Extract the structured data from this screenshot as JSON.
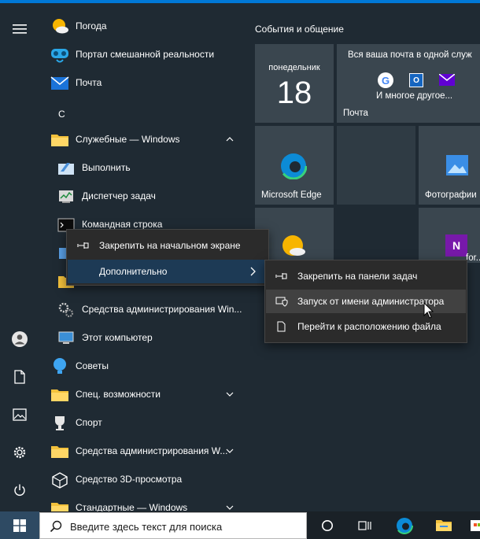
{
  "start_menu": {
    "apps": [
      {
        "label": "Погода",
        "icon": "weather-icon"
      },
      {
        "label": "Портал смешанной реальности",
        "icon": "mixed-reality-icon"
      },
      {
        "label": "Почта",
        "icon": "mail-icon"
      },
      {
        "label": "Служебные — Windows",
        "icon": "folder-icon"
      },
      {
        "label": "Выполнить",
        "icon": "run-icon"
      },
      {
        "label": "Диспетчер задач",
        "icon": "task-manager-icon"
      },
      {
        "label": "Командная строка",
        "icon": "cmd-icon"
      },
      {
        "label": "Средства администрирования Win...",
        "icon": "admin-tools-icon"
      },
      {
        "label": "Этот компьютер",
        "icon": "computer-icon"
      },
      {
        "label": "Советы",
        "icon": "tips-icon"
      },
      {
        "label": "Спец. возможности",
        "icon": "folder-icon"
      },
      {
        "label": "Спорт",
        "icon": "sport-icon"
      },
      {
        "label": "Средства администрирования W...",
        "icon": "folder-icon"
      },
      {
        "label": "Средство 3D-просмотра",
        "icon": "3d-viewer-icon"
      },
      {
        "label": "Стандартные — Windows",
        "icon": "folder-icon"
      }
    ],
    "letter_header": "С"
  },
  "tiles": {
    "group_title": "События и общение",
    "calendar": {
      "day": "понедельник",
      "date": "18"
    },
    "mail": {
      "headline": "Вся ваша почта в одной служ",
      "more": "И многое другое...",
      "label": "Почта"
    },
    "edge": {
      "label": "Microsoft Edge"
    },
    "photos": {
      "label": "Фотографии"
    },
    "onenote": {
      "label": "for..."
    }
  },
  "context_menu": {
    "pin_start": "Закрепить на начальном экране",
    "more": "Дополнительно"
  },
  "submenu": {
    "pin_taskbar": "Закрепить на панели задач",
    "run_as_admin": "Запуск от имени администратора",
    "open_location": "Перейти к расположению файла"
  },
  "taskbar": {
    "search_placeholder": "Введите здесь текст для поиска"
  },
  "colors": {
    "accent": "#0078d7",
    "background": "#1f2a33",
    "tile": "#3a464f",
    "menu": "#2b2b2b"
  }
}
